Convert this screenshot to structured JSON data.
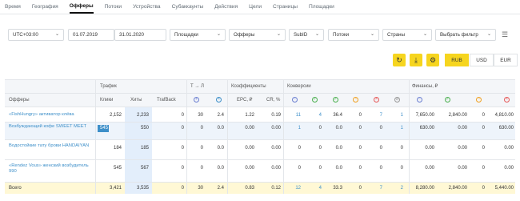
{
  "nav": {
    "tabs": [
      "Время",
      "География",
      "Офферы",
      "Потоки",
      "Устройства",
      "Субаккаунты",
      "Действия",
      "Цели",
      "Страницы",
      "Площадки"
    ],
    "active": "Офферы"
  },
  "filters": {
    "timezone": "UTC+03:00",
    "date_from": "01.07.2019",
    "date_to": "31.01.2020",
    "platforms": "Площадки",
    "offers": "Офферы",
    "subid": "SubID",
    "streams": "Потоки",
    "countries": "Страны",
    "choose_filter": "Выбрать фильтр"
  },
  "toolbar": {
    "icons": [
      "refresh-icon",
      "download-icon",
      "settings-icon"
    ],
    "currencies": [
      "RUB",
      "USD",
      "EUR"
    ],
    "active_currency": "RUB"
  },
  "table": {
    "group_headers": {
      "traffic": "Трафик",
      "tl": "Т → Л",
      "coefficients": "Коэффициенты",
      "conversions": "Конверсии",
      "finance": "Финансы, ₽"
    },
    "col_headers": {
      "offers": "Офферы",
      "clicks": "Клики",
      "hits": "Хиты",
      "trafback": "TrafBack",
      "epc": "EPC, ₽",
      "cr": "CR, %"
    },
    "rows": [
      {
        "name": "«FishHungry» активатор клёва",
        "clicks": "2,152",
        "hits": "2,233",
        "trafback": "0",
        "tl1": "30",
        "tl2": "2.4",
        "epc": "1.22",
        "cr": "0.19",
        "c1": "11",
        "c2": "4",
        "c3": "36.4",
        "c4": "0",
        "c5": "7",
        "c6": "1",
        "f1": "7,650.00",
        "f2": "2,840.00",
        "f3": "0",
        "f4": "4,810.00"
      },
      {
        "name": "Возбуждающий кофе SWEET MEET",
        "clicks": "545",
        "hits": "550",
        "trafback": "0",
        "tl1": "0",
        "tl2": "0.0",
        "epc": "0.00",
        "cr": "0.00",
        "c1": "1",
        "c2": "0",
        "c3": "0.0",
        "c4": "0",
        "c5": "0",
        "c6": "1",
        "f1": "630.00",
        "f2": "0.00",
        "f3": "0",
        "f4": "630.00"
      },
      {
        "name": "Водостойкие тату брови HANDAIYAN",
        "clicks": "184",
        "hits": "185",
        "trafback": "0",
        "tl1": "0",
        "tl2": "0.0",
        "epc": "0.00",
        "cr": "0.00",
        "c1": "0",
        "c2": "0",
        "c3": "0.0",
        "c4": "0",
        "c5": "0",
        "c6": "0",
        "f1": "0.00",
        "f2": "0.00",
        "f3": "0",
        "f4": "0.00"
      },
      {
        "name": "«Rendez Vous» женский возбудитель 990",
        "clicks": "545",
        "hits": "567",
        "trafback": "0",
        "tl1": "0",
        "tl2": "0.0",
        "epc": "0.00",
        "cr": "0.00",
        "c1": "0",
        "c2": "0",
        "c3": "0.0",
        "c4": "0",
        "c5": "0",
        "c6": "0",
        "f1": "0.00",
        "f2": "0.00",
        "f3": "0",
        "f4": "0.00"
      }
    ],
    "total": {
      "name": "Всего",
      "clicks": "3,421",
      "hits": "3,535",
      "trafback": "0",
      "tl1": "30",
      "tl2": "2.4",
      "epc": "0.83",
      "cr": "0.12",
      "c1": "12",
      "c2": "4",
      "c3": "33.3",
      "c4": "0",
      "c5": "7",
      "c6": "2",
      "f1": "8,280.00",
      "f2": "2,840.00",
      "f3": "0",
      "f4": "5,440.00"
    }
  },
  "colors": {
    "accent": "#f6d51f",
    "link": "#3d8fc9",
    "selected_row": "#eef4fb",
    "header_bg": "#f4f6f9",
    "total_bg": "#fff8d5"
  }
}
